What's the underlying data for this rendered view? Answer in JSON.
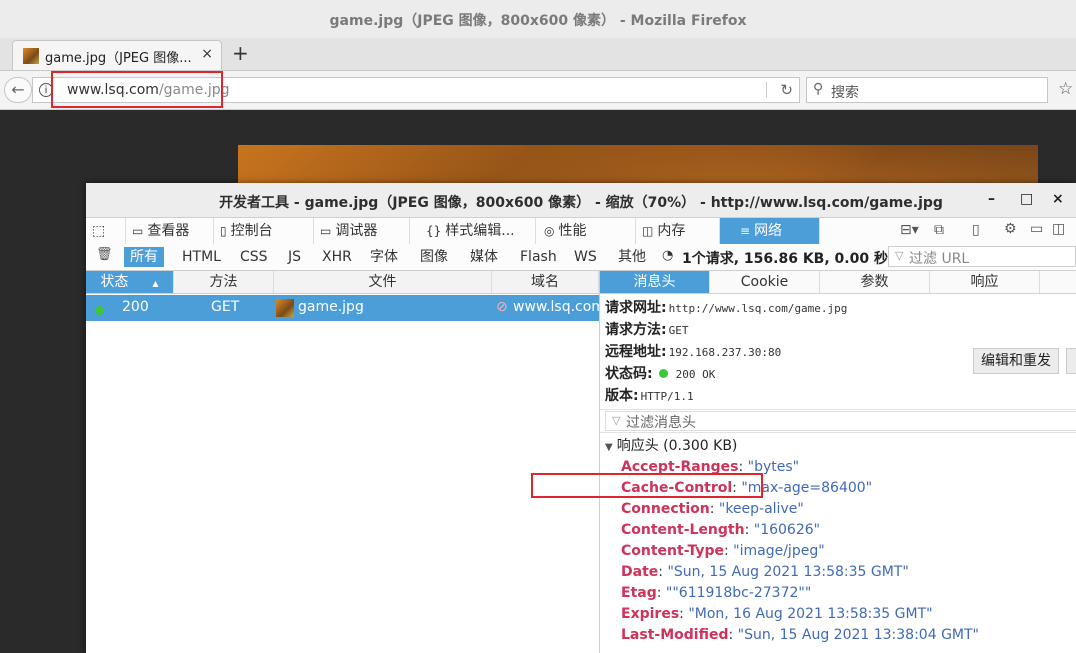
{
  "window": {
    "title": "game.jpg（JPEG 图像，800x600 像素） - Mozilla Firefox"
  },
  "tab": {
    "label": "game.jpg（JPEG 图像...",
    "close": "×",
    "new": "+"
  },
  "navbar": {
    "back": "←",
    "info": "i",
    "url_host": "www.lsq.com",
    "url_path": "/game.jpg",
    "reload": "↻",
    "search_placeholder": "搜索",
    "search_icon": "⚲",
    "star": "☆"
  },
  "devtools": {
    "title": "开发者工具 - game.jpg（JPEG 图像，800x600 像素） - 缩放（70%） - http://www.lsq.com/game.jpg",
    "tabs": [
      {
        "label": "查看器",
        "icon": "▭"
      },
      {
        "label": "控制台",
        "icon": "▯"
      },
      {
        "label": "调试器",
        "icon": "▭"
      },
      {
        "label": "样式编辑...",
        "icon": "{}"
      },
      {
        "label": "性能",
        "icon": "◎"
      },
      {
        "label": "内存",
        "icon": "◫"
      },
      {
        "label": "网络",
        "icon": "≡"
      }
    ],
    "filters": [
      "所有",
      "HTML",
      "CSS",
      "JS",
      "XHR",
      "字体",
      "图像",
      "媒体",
      "Flash",
      "WS",
      "其他"
    ],
    "trash_icon": "🗑",
    "summary": "1个请求, 156.86 KB, 0.00 秒",
    "filter_url_placeholder": "过滤 URL",
    "columns": [
      "状态",
      "方法",
      "文件",
      "域名"
    ],
    "request": {
      "status": "200",
      "method": "GET",
      "file": "game.jpg",
      "domain": "www.lsq.com"
    },
    "detail_tabs": [
      "消息头",
      "Cookie",
      "参数",
      "响应"
    ],
    "summary_fields": [
      {
        "key": "请求网址:",
        "value": "http://www.lsq.com/game.jpg"
      },
      {
        "key": "请求方法:",
        "value": "GET"
      },
      {
        "key": "远程地址:",
        "value": "192.168.237.30:80"
      },
      {
        "key": "状态码:",
        "value": "200 OK"
      },
      {
        "key": "版本:",
        "value": "HTTP/1.1"
      }
    ],
    "resend_label": "编辑和重发",
    "header_filter_placeholder": "过滤消息头",
    "response_headers_title": "响应头 (0.300 KB)",
    "response_headers": [
      {
        "name": "Accept-Ranges",
        "value": "\"bytes\""
      },
      {
        "name": "Cache-Control",
        "value": "\"max-age=86400\""
      },
      {
        "name": "Connection",
        "value": "\"keep-alive\""
      },
      {
        "name": "Content-Length",
        "value": "\"160626\""
      },
      {
        "name": "Content-Type",
        "value": "\"image/jpeg\""
      },
      {
        "name": "Date",
        "value": "\"Sun, 15 Aug 2021 13:58:35 GMT\""
      },
      {
        "name": "Etag",
        "value": "\"\"611918bc-27372\"\""
      },
      {
        "name": "Expires",
        "value": "\"Mon, 16 Aug 2021 13:58:35 GMT\""
      },
      {
        "name": "Last-Modified",
        "value": "\"Sun, 15 Aug 2021 13:38:04 GMT\""
      }
    ]
  },
  "colors": {
    "accent": "#4c9ed9",
    "highlight_box": "#e0262d",
    "header_name": "#d0325a",
    "header_value": "#4069b7",
    "status_ok": "#3cc63c"
  }
}
